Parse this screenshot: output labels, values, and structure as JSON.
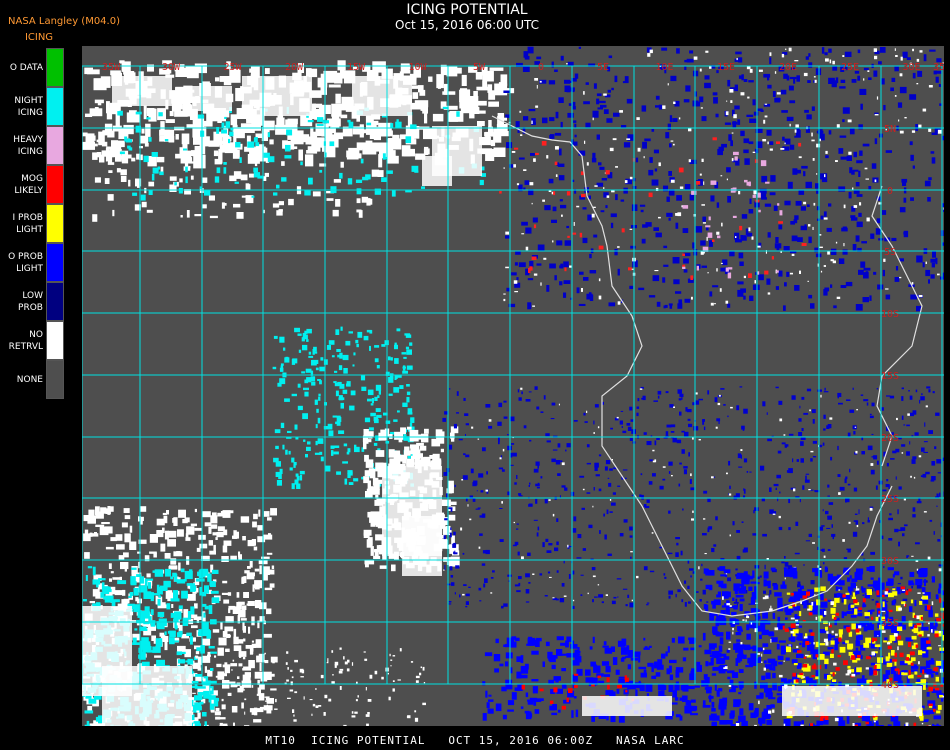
{
  "header": {
    "producer": "NASA Langley (M04.0)",
    "legend_title": "ICING",
    "title": "ICING POTENTIAL",
    "subtitle": "Oct 15, 2016 06:00 UTC"
  },
  "legend": {
    "items": [
      {
        "label": "O DATA",
        "color": "#00c000"
      },
      {
        "label": "NIGHT\nICING",
        "color": "#00f0f0"
      },
      {
        "label": "HEAVY\nICING",
        "color": "#e8a8e0"
      },
      {
        "label": "MOG\nLIKELY",
        "color": "#ff0000"
      },
      {
        "label": "I PROB\nLIGHT",
        "color": "#ffff00"
      },
      {
        "label": "O PROB\nLIGHT",
        "color": "#0000ff"
      },
      {
        "label": "LOW\nPROB",
        "color": "#000080"
      },
      {
        "label": "NO\nRETRVL",
        "color": "#ffffff"
      },
      {
        "label": "NONE",
        "color": "#4e4e4e"
      }
    ]
  },
  "map": {
    "background_color": "#4e4e4e",
    "grid_color": "#00e0e0",
    "coastline_color": "#e0e0e0",
    "lon_labels": [
      "35W",
      "30W",
      "25W",
      "20W",
      "15W",
      "10W",
      "5W",
      "0",
      "5E",
      "10E",
      "15E",
      "20E",
      "25E",
      "30E",
      "35E"
    ],
    "lat_labels": [
      "5N",
      "0",
      "5S",
      "10S",
      "15S",
      "20S",
      "25S",
      "30S",
      "35S",
      "40S"
    ]
  },
  "footer": {
    "text": "MT10  ICING POTENTIAL   OCT 15, 2016 06:00Z   NASA LARC"
  }
}
